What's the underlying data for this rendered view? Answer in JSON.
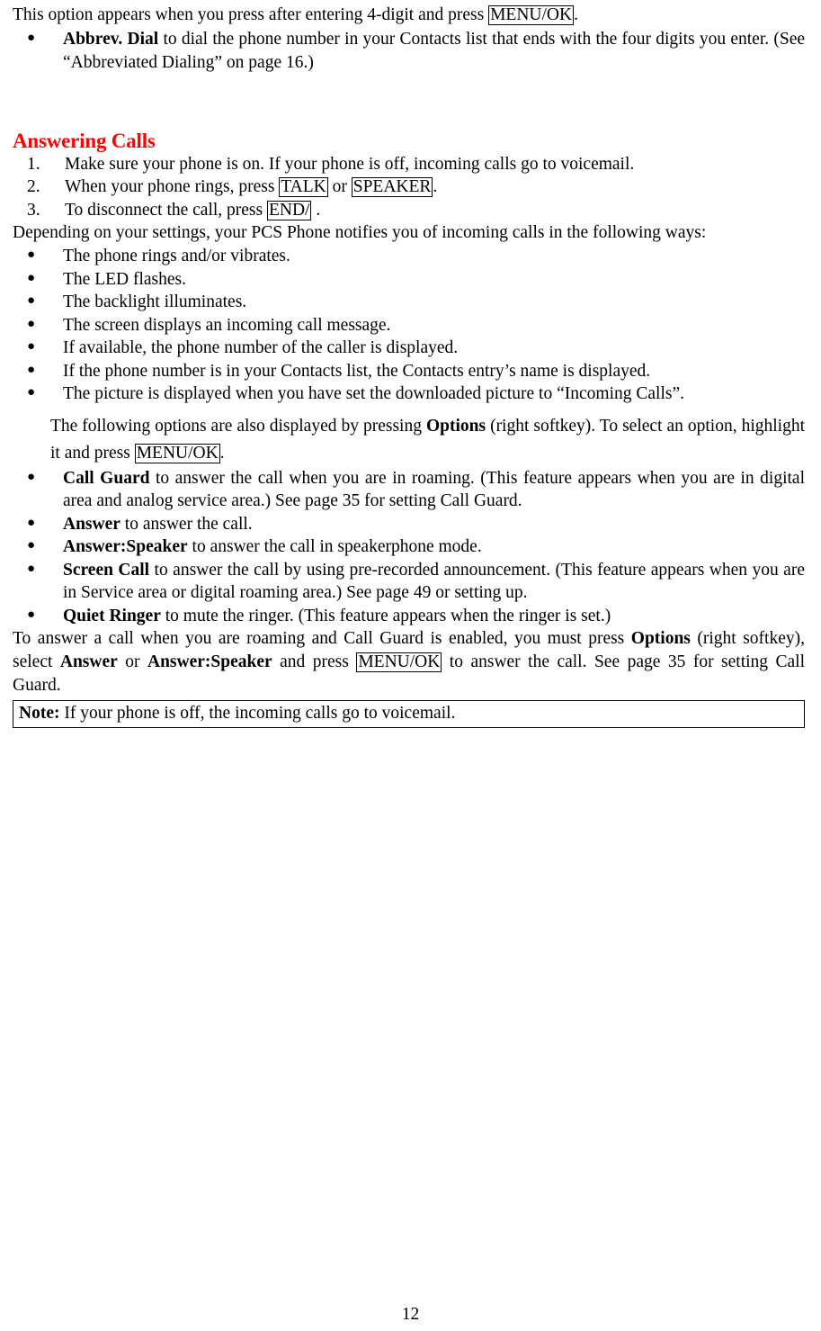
{
  "document": {
    "intro_line": {
      "before_key": "This option appears when you press after entering 4-digit and press ",
      "key": "MENU/OK",
      "after_key": "."
    },
    "abbrev_bullet": {
      "bold": "Abbrev. Dial",
      "text": " to dial the phone number in your Contacts list that ends with the four digits you enter. (See “Abbreviated Dialing” on page 16.)"
    },
    "section_title": "Answering Calls",
    "steps": [
      {
        "num": "1.",
        "parts": [
          {
            "type": "text",
            "value": "Make sure your phone is on. If your phone is off, incoming calls go to voicemail."
          }
        ]
      },
      {
        "num": "2.",
        "parts": [
          {
            "type": "text",
            "value": "When your phone rings, press "
          },
          {
            "type": "key",
            "value": "TALK"
          },
          {
            "type": "text",
            "value": " or "
          },
          {
            "type": "key",
            "value": "SPEAKER"
          },
          {
            "type": "text",
            "value": "."
          }
        ]
      },
      {
        "num": "3.",
        "parts": [
          {
            "type": "text",
            "value": "To disconnect the call, press "
          },
          {
            "type": "key",
            "value": "END/"
          },
          {
            "type": "text",
            "value": " ."
          }
        ]
      }
    ],
    "depending_para": "Depending on your settings, your PCS Phone notifies you of incoming calls in the following ways:",
    "notify_bullets": [
      "The phone rings and/or vibrates.",
      "The LED flashes.",
      "The backlight illuminates.",
      "The screen displays an incoming call message.",
      "If available, the phone number of the caller is displayed.",
      "If the phone number is in your Contacts list, the Contacts entry’s name is displayed.",
      "The picture is displayed when you have set the downloaded picture to “Incoming Calls”."
    ],
    "options_para": {
      "p1": "The following options are also displayed by pressing ",
      "bold1": "Options",
      "p2": " (right softkey). To select an option, highlight it and press ",
      "key1": "MENU/OK",
      "p3": "."
    },
    "option_bullets": [
      {
        "bold": "Call Guard",
        "text": " to answer the call when you are in roaming. (This feature appears when you are in digital area and analog service area.) See page 35 for setting Call Guard."
      },
      {
        "bold": "Answer",
        "text": " to answer the call."
      },
      {
        "bold": "Answer:Speaker",
        "text": " to answer the call in speakerphone mode."
      },
      {
        "bold": "Screen Call",
        "text": " to answer the call by using pre-recorded announcement. (This feature appears when you are in Service area or digital roaming area.) See page 49 or setting up."
      },
      {
        "bold": "Quiet Ringer",
        "text": " to mute the ringer. (This feature appears when the ringer is set.)"
      }
    ],
    "roaming_para": {
      "p1": "To answer a call when you are roaming and Call Guard is enabled, you must press ",
      "bold1": "Options",
      "p2": " (right softkey), select ",
      "bold2": "Answer",
      "p3": " or ",
      "bold3": "Answer:Speaker",
      "p4": " and press ",
      "key1": "MENU/OK",
      "p5": " to answer the call. See page 35 for setting Call Guard."
    },
    "note": {
      "label": "Note:",
      "text": " If your phone is off, the incoming calls go to voicemail."
    },
    "page_number": "12",
    "colors": {
      "heading": "#ff0000",
      "text": "#000000",
      "background": "#ffffff"
    }
  }
}
